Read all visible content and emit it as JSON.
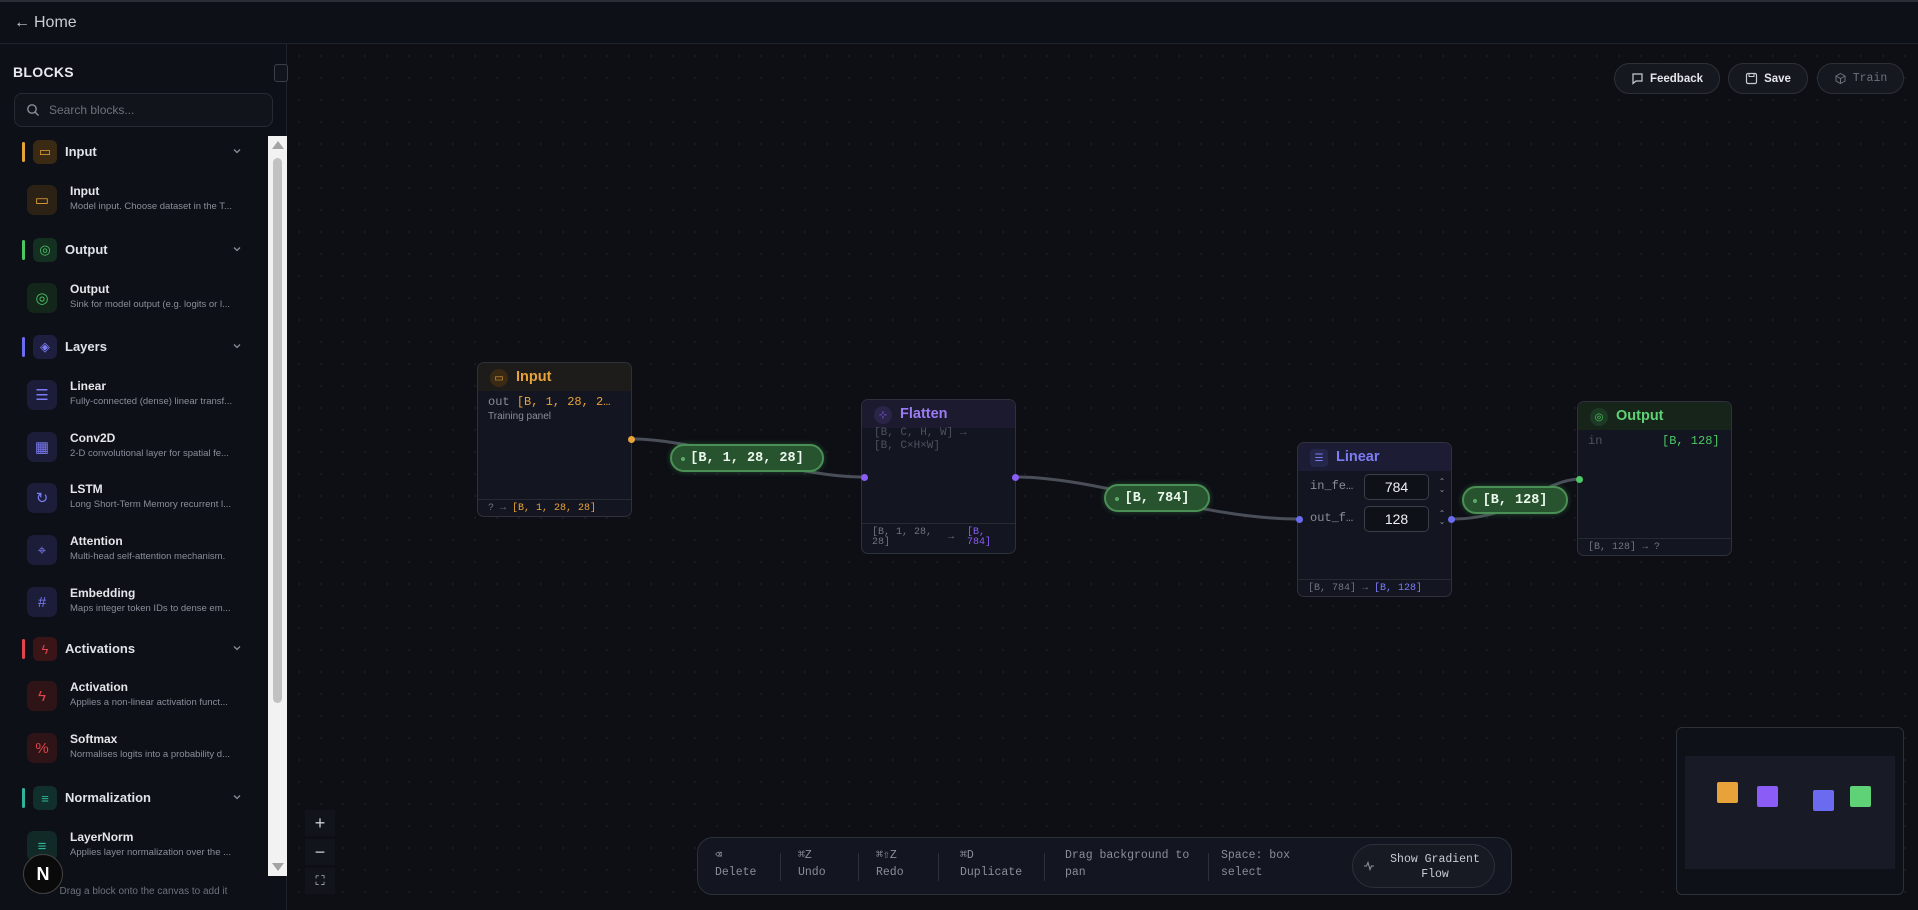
{
  "topbar": {
    "home_arrow": "←",
    "home_label": "Home"
  },
  "sidebar": {
    "title": "BLOCKS",
    "search_placeholder": "Search blocks...",
    "footer": "Drag a block onto the canvas to add it",
    "categories": [
      {
        "label": "Input",
        "color": "#e8a23a",
        "icon": "inbox-icon"
      },
      {
        "label": "Output",
        "color": "#4cc764",
        "icon": "target-icon"
      },
      {
        "label": "Layers",
        "color": "#6b6bf0",
        "icon": "layers-icon"
      },
      {
        "label": "Activations",
        "color": "#e0444c",
        "icon": "zap-icon"
      },
      {
        "label": "Normalization",
        "color": "#2fb39b",
        "icon": "sliders-icon"
      }
    ],
    "items": [
      {
        "name": "Input",
        "desc": "Model input. Choose dataset in the T...",
        "icon": "inbox-icon"
      },
      {
        "name": "Output",
        "desc": "Sink for model output (e.g. logits or l...",
        "icon": "target-icon"
      },
      {
        "name": "Linear",
        "desc": "Fully-connected (dense) linear transf...",
        "icon": "linear-icon"
      },
      {
        "name": "Conv2D",
        "desc": "2-D convolutional layer for spatial fe...",
        "icon": "grid-icon"
      },
      {
        "name": "LSTM",
        "desc": "Long Short-Term Memory recurrent l...",
        "icon": "refresh-icon"
      },
      {
        "name": "Attention",
        "desc": "Multi-head self-attention mechanism.",
        "icon": "focus-icon"
      },
      {
        "name": "Embedding",
        "desc": "Maps integer token IDs to dense em...",
        "icon": "hash-icon"
      },
      {
        "name": "Activation",
        "desc": "Applies a non-linear activation funct...",
        "icon": "zap-icon"
      },
      {
        "name": "Softmax",
        "desc": "Normalises logits into a probability d...",
        "icon": "percent-icon"
      },
      {
        "name": "LayerNorm",
        "desc": "Applies layer normalization over the ...",
        "icon": "sliders-icon"
      }
    ]
  },
  "toolbar": {
    "feedback": "Feedback",
    "save": "Save",
    "train": "Train"
  },
  "nodes": {
    "input": {
      "title": "Input",
      "out_key": "out",
      "out_val": "[B, 1, 28, 2…",
      "sub": "Training panel",
      "foot_in": "? →",
      "foot_out": "[B, 1, 28, 28]"
    },
    "flatten": {
      "title": "Flatten",
      "desc1": "[B, C, H, W] →",
      "desc2": "[B, C×H×W]",
      "foot_in1": "[B, 1, 28,",
      "foot_in2": "28]",
      "foot_arrow": "→",
      "foot_out1": "[B,",
      "foot_out2": "784]"
    },
    "linear": {
      "title": "Linear",
      "f1_label": "in_fe…",
      "f1_value": "784",
      "f2_label": "out_f…",
      "f2_value": "128",
      "foot_in": "[B, 784] →",
      "foot_out": "[B, 128]"
    },
    "output": {
      "title": "Output",
      "in_key": "in",
      "in_val": "[B, 128]",
      "foot": "[B, 128] → ?"
    }
  },
  "edges": {
    "e1": "[B, 1, 28, 28]",
    "e2": "[B, 784]",
    "e3": "[B, 128]"
  },
  "zoom": {
    "in": "+",
    "out": "−",
    "fit": "⛶"
  },
  "bottombar": {
    "delete_key": "⌫",
    "delete_label": "Delete",
    "undo_key": "⌘Z",
    "undo_label": "Undo",
    "redo_key": "⌘⇧Z",
    "redo_label": "Redo",
    "dup_key": "⌘D",
    "dup_label": "Duplicate",
    "pan_1": "Drag background to",
    "pan_2": "pan",
    "box_1": "Space: box",
    "box_2": "select",
    "grad_1": "Show Gradient",
    "grad_2": "Flow"
  },
  "minimap_colors": [
    "#e8a23a",
    "#8b5cf6",
    "#6b6bf0",
    "#4cc764"
  ]
}
